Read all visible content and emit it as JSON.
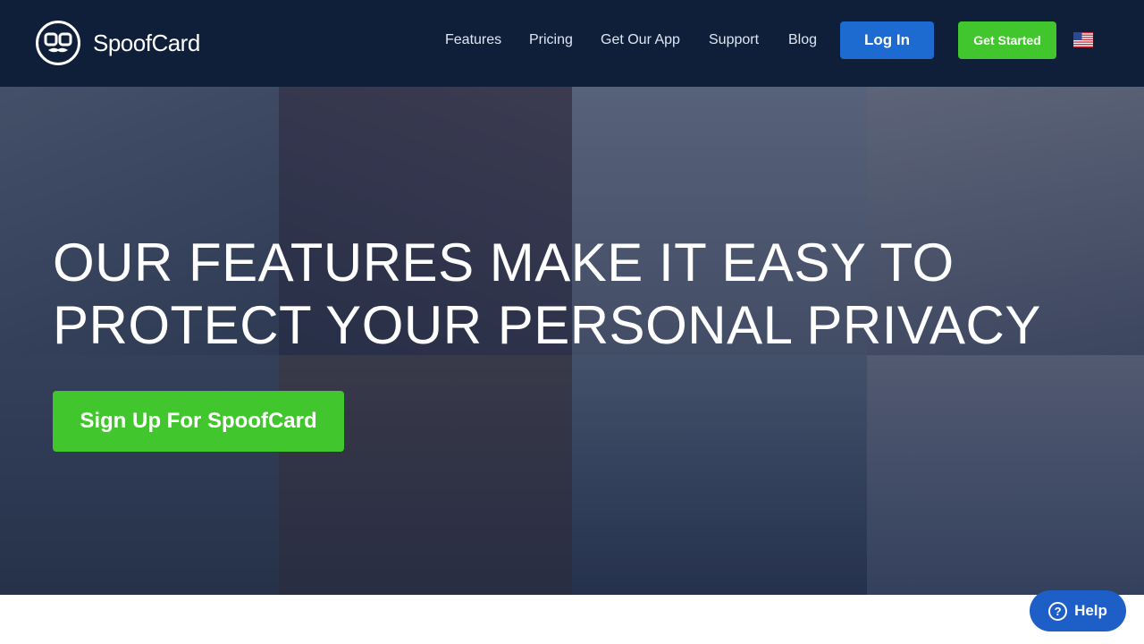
{
  "header": {
    "brand": "SpoofCard",
    "nav": [
      "Features",
      "Pricing",
      "Get Our App",
      "Support",
      "Blog"
    ],
    "login_label": "Log In",
    "get_started_label": "Get Started",
    "language_flag": "us-flag-icon"
  },
  "hero": {
    "title": "OUR FEATURES MAKE IT EASY TO PROTECT YOUR PERSONAL PRIVACY",
    "cta_label": "Sign Up For SpoofCard"
  },
  "help": {
    "label": "Help",
    "icon_glyph": "?"
  },
  "colors": {
    "navy": "#0f1f3a",
    "blue": "#1d6ad1",
    "green": "#42c62d",
    "help_blue": "#1d5fc7"
  }
}
